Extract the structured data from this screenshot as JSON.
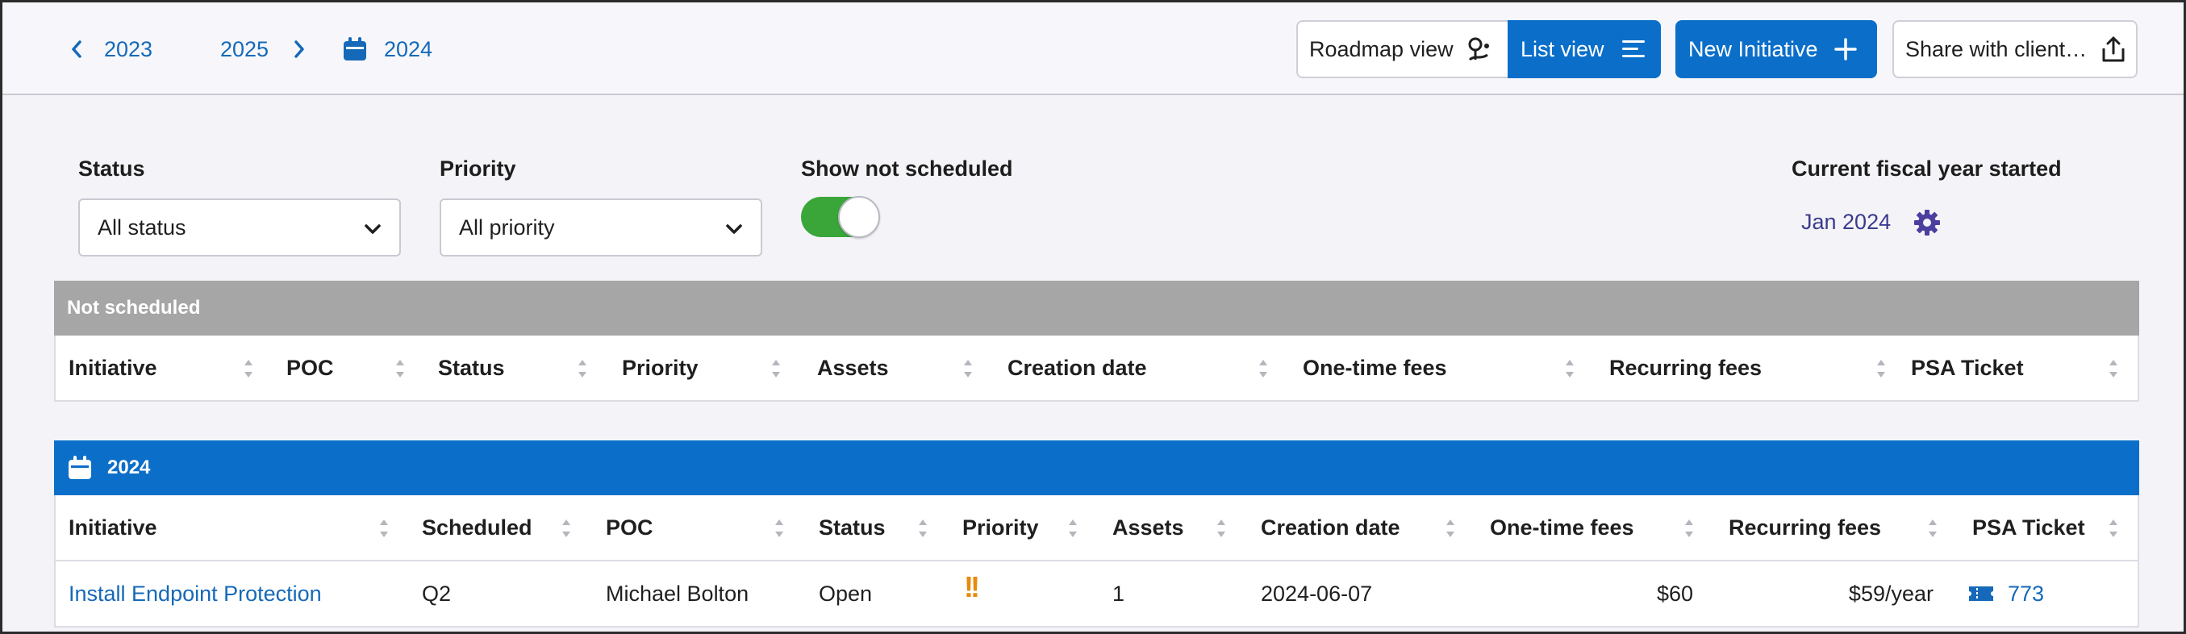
{
  "nav": {
    "prev_year": "2023",
    "next_year": "2025",
    "current_year": "2024"
  },
  "toolbar": {
    "roadmap_view": "Roadmap view",
    "list_view": "List view",
    "new_initiative": "New Initiative",
    "share": "Share with client…"
  },
  "filters": {
    "status_label": "Status",
    "status_value": "All status",
    "priority_label": "Priority",
    "priority_value": "All priority",
    "show_not_scheduled_label": "Show not scheduled",
    "show_not_scheduled_on": true,
    "fiscal_label": "Current fiscal year started",
    "fiscal_value": "Jan 2024"
  },
  "not_scheduled": {
    "title": "Not scheduled",
    "columns": [
      "Initiative",
      "POC",
      "Status",
      "Priority",
      "Assets",
      "Creation date",
      "One-time fees",
      "Recurring fees",
      "PSA Ticket"
    ]
  },
  "year_section": {
    "title": "2024",
    "columns": [
      "Initiative",
      "Scheduled",
      "POC",
      "Status",
      "Priority",
      "Assets",
      "Creation date",
      "One-time fees",
      "Recurring fees",
      "PSA Ticket"
    ],
    "rows": [
      {
        "initiative": "Install Endpoint Protection",
        "scheduled": "Q2",
        "poc": "Michael Bolton",
        "status": "Open",
        "priority": "!!",
        "assets": "1",
        "creation_date": "2024-06-07",
        "one_time_fees": "$60",
        "recurring_fees": "$59/year",
        "psa_ticket": "773"
      }
    ]
  },
  "colors": {
    "accent_blue": "#0b6fc9",
    "link_blue": "#1569b8",
    "not_scheduled_header": "#a6a6a6",
    "toggle_on": "#3aa63a",
    "priority_high": "#e88a0c",
    "fiscal_text": "#3b3b8f"
  }
}
